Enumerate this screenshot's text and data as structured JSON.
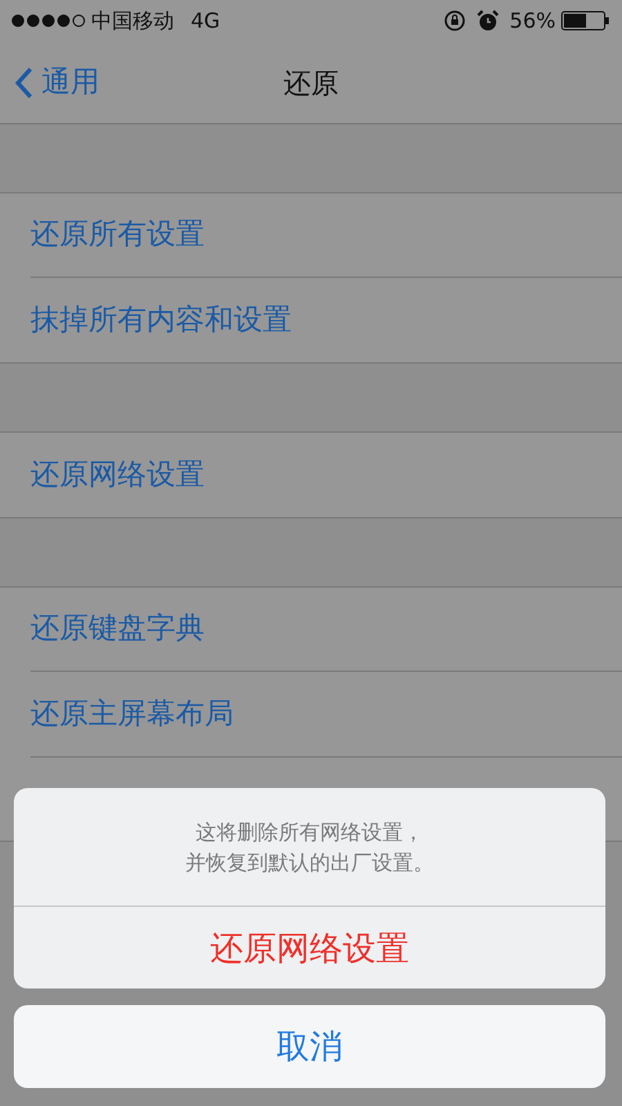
{
  "status_bar": {
    "carrier": "中国移动",
    "network": "4G",
    "battery": "56%"
  },
  "nav": {
    "back": "通用",
    "title": "还原"
  },
  "groups": [
    {
      "items": [
        "还原所有设置",
        "抹掉所有内容和设置"
      ]
    },
    {
      "items": [
        "还原网络设置"
      ]
    },
    {
      "items": [
        "还原键盘字典",
        "还原主屏幕布局"
      ]
    }
  ],
  "action_sheet": {
    "message": [
      "这将删除所有网络设置，",
      "并恢复到默认的出厂设置。"
    ],
    "destructive": "还原网络设置",
    "cancel": "取消"
  }
}
